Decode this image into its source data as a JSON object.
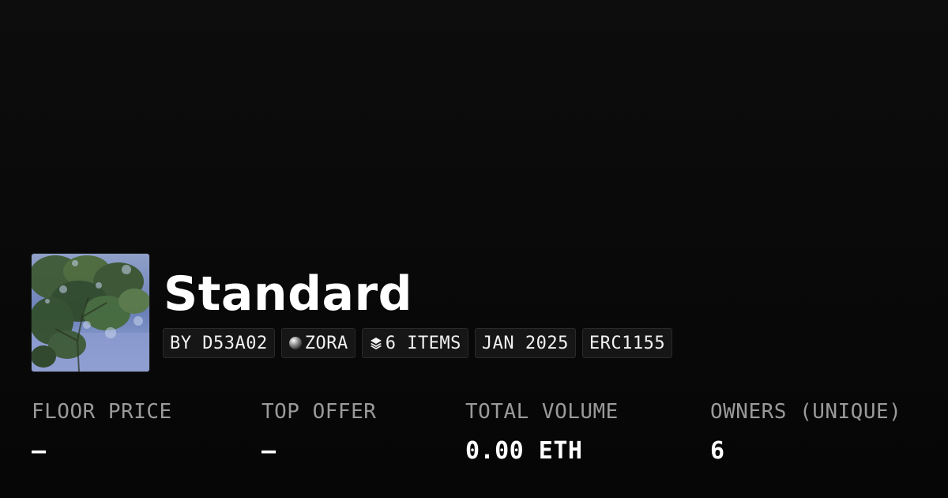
{
  "collection": {
    "title": "Standard",
    "badges": {
      "creator": "BY D53A02",
      "network": "ZORA",
      "items": "6 ITEMS",
      "date": "JAN 2025",
      "standard": "ERC1155"
    },
    "icons": {
      "network": "zora-orb-icon",
      "items": "layers-icon"
    }
  },
  "stats": [
    {
      "label": "FLOOR PRICE",
      "value": "–"
    },
    {
      "label": "TOP OFFER",
      "value": "–"
    },
    {
      "label": "TOTAL VOLUME",
      "value": "0.00 ETH"
    },
    {
      "label": "OWNERS (UNIQUE)",
      "value": "6"
    }
  ],
  "colors": {
    "background": "#0a0a0a",
    "badge_background": "#161616",
    "label": "#9a9a9a",
    "text": "#ffffff"
  }
}
